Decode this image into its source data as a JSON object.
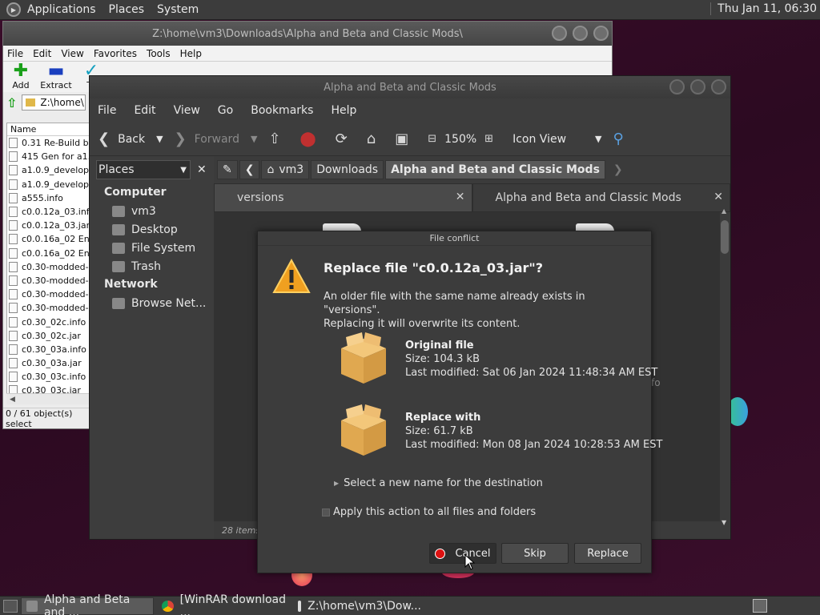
{
  "top_panel": {
    "menus": [
      "Applications",
      "Places",
      "System"
    ],
    "clock": "Thu Jan 11, 06:30"
  },
  "winrar": {
    "title": "Z:\\home\\vm3\\Downloads\\Alpha and Beta and Classic Mods\\",
    "menus": [
      "File",
      "Edit",
      "View",
      "Favorites",
      "Tools",
      "Help"
    ],
    "tools": [
      {
        "label": "Add",
        "icon": "plus-icon",
        "color": "#1aa01a"
      },
      {
        "label": "Extract",
        "icon": "minus-icon",
        "color": "#1a3fbf"
      },
      {
        "label": "Te",
        "icon": "test-icon",
        "color": "#15a0c0"
      }
    ],
    "address": "Z:\\home\\",
    "column_name": "Name",
    "files": [
      "0.31 Re-Build buil",
      "415 Gen for a1.0.",
      "a1.0.9_developme",
      "a1.0.9_developme",
      "a555.info",
      "c0.0.12a_03.info",
      "c0.0.12a_03.jar",
      "c0.0.16a_02 Enha",
      "c0.0.16a_02 Enha",
      "c0.30-modded-cre",
      "c0.30-modded-cre",
      "c0.30-modded-su",
      "c0.30-modded-su",
      "c0.30_02c.info",
      "c0.30_02c.jar",
      "c0.30_03a.info",
      "c0.30_03a.jar",
      "c0.30_03c.info",
      "c0.30_03c.jar"
    ],
    "status": "0 / 61 object(s) select"
  },
  "caja": {
    "title": "Alpha and Beta and Classic Mods",
    "menus": [
      "File",
      "Edit",
      "View",
      "Go",
      "Bookmarks",
      "Help"
    ],
    "toolbar": {
      "back": "Back",
      "forward": "Forward",
      "zoom": "150%",
      "view_mode": "Icon View"
    },
    "places_label": "Places",
    "sidebar": {
      "computer_heading": "Computer",
      "computer_items": [
        "vm3",
        "Desktop",
        "File System",
        "Trash"
      ],
      "network_heading": "Network",
      "network_items": [
        "Browse Net..."
      ]
    },
    "path": [
      "vm3",
      "Downloads",
      "Alpha and Beta and Classic Mods"
    ],
    "tabs": [
      "versions",
      "Alpha and Beta and Classic Mods"
    ],
    "items_count": "28 items",
    "partial_text": "fo"
  },
  "dialog": {
    "title": "File conflict",
    "heading": "Replace file \"c0.0.12a_03.jar\"?",
    "desc_line1": "An older file with the same name already exists in \"versions\".",
    "desc_line2": "Replacing it will overwrite its content.",
    "original": {
      "title": "Original file",
      "size": "Size: 104.3 kB",
      "modified": "Last modified: Sat 06 Jan 2024 11:48:34 AM EST"
    },
    "replacement": {
      "title": "Replace with",
      "size": "Size: 61.7 kB",
      "modified": "Last modified: Mon 08 Jan 2024 10:28:53 AM EST"
    },
    "rename_expander": "Select a new name for the destination",
    "apply_all": "Apply this action to all files and folders",
    "buttons": {
      "cancel": "Cancel",
      "skip": "Skip",
      "replace": "Replace"
    }
  },
  "taskbar": {
    "tasks": [
      "Alpha and Beta and ...",
      "[WinRAR download ...",
      "Z:\\home\\vm3\\Dow..."
    ]
  }
}
